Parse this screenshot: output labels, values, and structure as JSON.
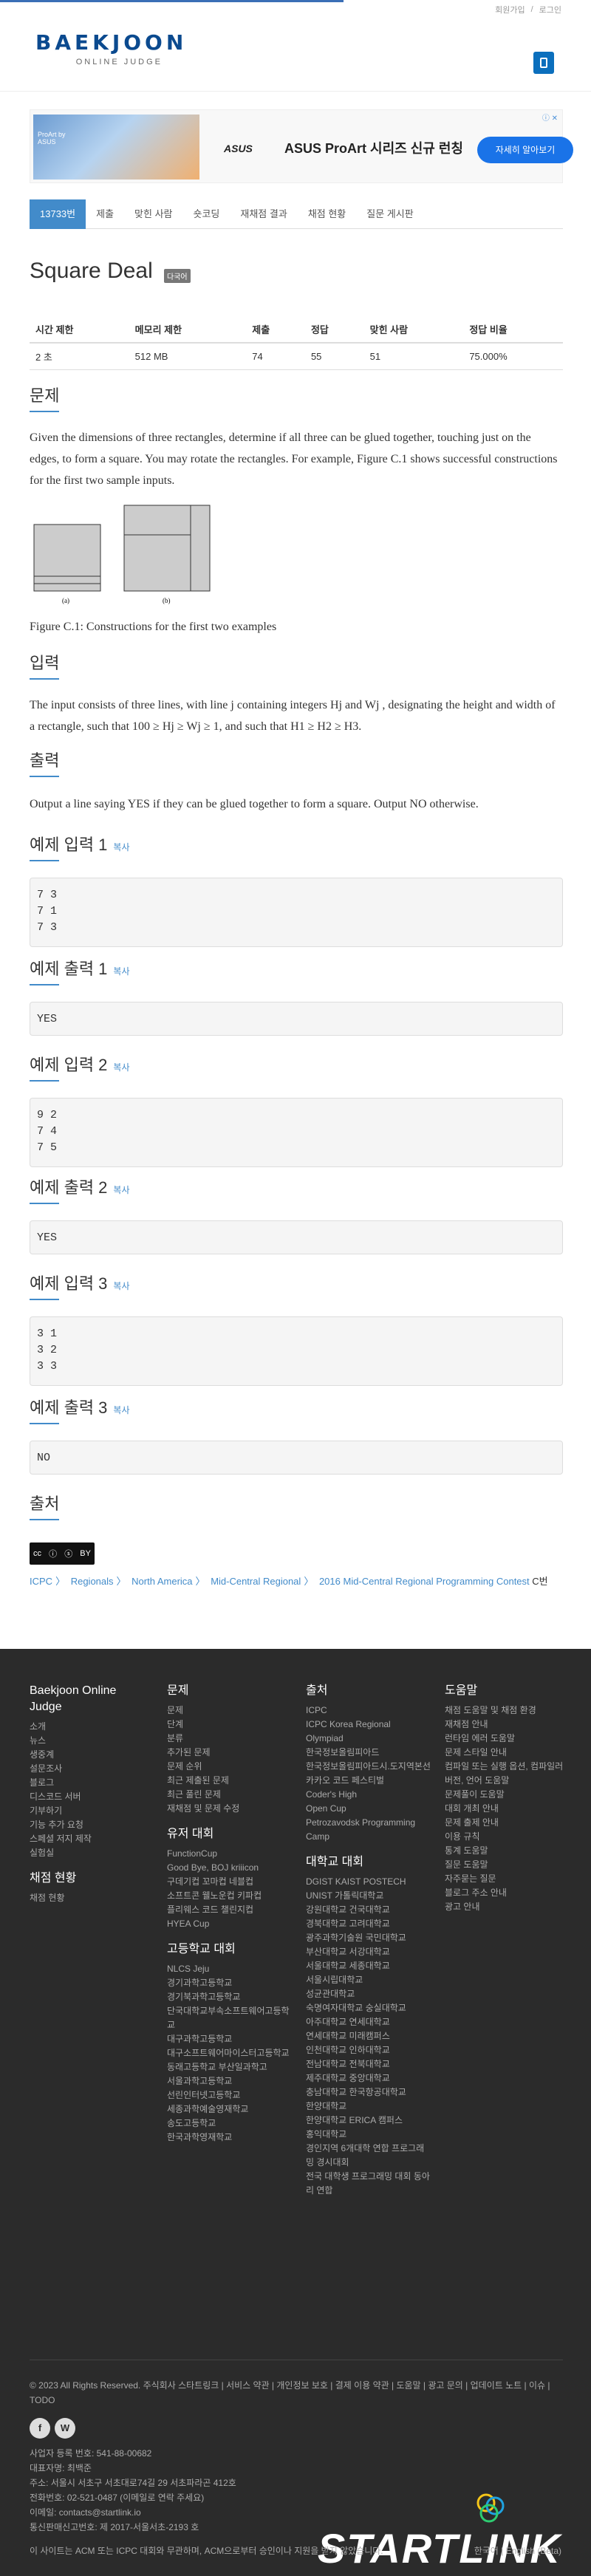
{
  "topbar": {
    "signup": "회원가입",
    "login": "로그인"
  },
  "logo": {
    "main": "BAEKJOON",
    "sub": "ONLINE JUDGE"
  },
  "ad": {
    "brand": "ASUS",
    "text": "ASUS ProArt 시리즈 신규 런칭",
    "button": "자세히 알아보기",
    "img_text": "ProArt by ASUS"
  },
  "tabs": [
    "13733번",
    "제출",
    "맞힌 사람",
    "숏코딩",
    "재채점 결과",
    "채점 현황",
    "질문 게시판"
  ],
  "problem": {
    "title": "Square Deal",
    "label": "다국어"
  },
  "info": {
    "headers": [
      "시간 제한",
      "메모리 제한",
      "제출",
      "정답",
      "맞힌 사람",
      "정답 비율"
    ],
    "values": [
      "2 초",
      "512 MB",
      "74",
      "55",
      "51",
      "75.000%"
    ]
  },
  "sections": {
    "problem": "문제",
    "input": "입력",
    "output": "출력",
    "source": "출처",
    "copy": "복사"
  },
  "text": {
    "problem": "Given the dimensions of three rectangles, determine if all three can be glued together, touching just on the edges, to form a square. You may rotate the rectangles. For example, Figure C.1 shows successful constructions for the first two sample inputs.",
    "caption": "Figure C.1: Constructions for the first two examples",
    "fig_a": "(a)",
    "fig_b": "(b)",
    "input": "The input consists of three lines, with line j containing integers Hj and Wj , designating the height and width of a rectangle, such that 100 ≥ Hj ≥ Wj ≥ 1, and such that H1 ≥ H2 ≥ H3.",
    "output": "Output a line saying YES if they can be glued together to form a square. Output NO otherwise."
  },
  "samples": [
    {
      "in_title": "예제 입력 1",
      "in": "7 3\n7 1\n7 3",
      "out_title": "예제 출력 1",
      "out": "YES"
    },
    {
      "in_title": "예제 입력 2",
      "in": "9 2\n7 4\n7 5",
      "out_title": "예제 출력 2",
      "out": "YES"
    },
    {
      "in_title": "예제 입력 3",
      "in": "3 1\n3 2\n3 3",
      "out_title": "예제 출력 3",
      "out": "NO"
    }
  ],
  "source": {
    "items": [
      "ICPC",
      "Regionals",
      "North America",
      "Mid-Central Regional",
      "2016 Mid-Central Regional Programming Contest"
    ],
    "suffix": "C번"
  },
  "footer": {
    "col1": {
      "title": "Baekjoon Online Judge",
      "items": [
        "소개",
        "뉴스",
        "생중계",
        "설문조사",
        "블로그",
        "디스코드 서버",
        "기부하기",
        "기능 추가 요청",
        "스페셜 저지 제작",
        "실험실"
      ],
      "title2": "채점 현황",
      "items2": [
        "채점 현황"
      ]
    },
    "col2": {
      "title": "문제",
      "items": [
        "문제",
        "단계",
        "분류",
        "추가된 문제",
        "문제 순위",
        "최근 제출된 문제",
        "최근 풀린 문제",
        "재채점 및 문제 수정"
      ],
      "title2": "유저 대회",
      "items2": [
        "FunctionCup",
        "Good Bye, BOJ kriiicon",
        "구데기컵 꼬마컵 네블컵",
        "소프트콘 웰노운컵 키파컵",
        "플리웨스 코드 챌린지컵",
        "HYEA Cup"
      ],
      "title3": "고등학교 대회",
      "items3": [
        "NLCS Jeju",
        "경기과학고등학교",
        "경기북과학고등학교",
        "단국대학교부속소프트웨어고등학교",
        "대구과학고등학교",
        "대구소프트웨어마이스터고등학교",
        "동래고등학교 부산일과학고",
        "서울과학고등학교",
        "선린인터넷고등학교",
        "세종과학예술영재학교",
        "송도고등학교",
        "한국과학영재학교"
      ]
    },
    "col3": {
      "title": "출처",
      "items": [
        "ICPC",
        "ICPC Korea Regional",
        "Olympiad",
        "한국정보올림피아드",
        "한국정보올림피아드시.도지역본선",
        "카카오 코드 페스티벌",
        "Coder's High",
        "Open Cup",
        "Petrozavodsk Programming Camp"
      ],
      "title2": "대학교 대회",
      "items2": [
        "DGIST KAIST POSTECH UNIST 가톨릭대학교",
        "강원대학교 건국대학교",
        "경북대학교 고려대학교",
        "광주과학기술원 국민대학교",
        "부산대학교 서강대학교",
        "서울대학교 세종대학교",
        "서울시립대학교",
        "성균관대학교",
        "숙명여자대학교 숭실대학교",
        "아주대학교 연세대학교",
        "연세대학교 미래캠퍼스",
        "인천대학교 인하대학교",
        "전남대학교 전북대학교",
        "제주대학교 중앙대학교",
        "충남대학교 한국항공대학교",
        "한양대학교",
        "한양대학교 ERICA 캠퍼스",
        "홍익대학교",
        "경인지역 6개대학 연합 프로그래밍 경시대회",
        "전국 대학생 프로그래밍 대회 동아리 연합"
      ]
    },
    "col4": {
      "title": "도움말",
      "items": [
        "채점 도움말 및 채점 환경",
        "재채점 안내",
        "런타임 에러 도움말",
        "문제 스타일 안내",
        "컴파일 또는 실행 옵션, 컴파일러 버전, 언어 도움말",
        "문제풀이 도움말",
        "대회 개최 안내",
        "문제 출제 안내",
        "이용 규칙",
        "통계 도움말",
        "질문 도움말",
        "자주묻는 질문",
        "블로그 주소 안내",
        "광고 안내"
      ]
    },
    "bottom_links": "© 2023 All Rights Reserved. 주식회사 스타트링크  |  서비스 약관  |  개인정보 보호  |  결제 이용 약관  |  도움말  |  광고 문의  |  업데이트 노트  |  이슈  |  TODO",
    "biz": [
      "사업자 등록 번호: 541-88-00682",
      "대표자명: 최백준",
      "주소: 서울시 서초구 서초대로74길 29 서초파라곤 412호",
      "전화번호: 02-521-0487 (이메일로 연락 주세요)",
      "이메일: contacts@startlink.io",
      "통신판매신고번호: 제 2017-서울서초-2193 호"
    ],
    "note": "이 사이트는 ACM 또는 ICPC 대회와 무관하며, ACM으로부터 승인이나 지원을 받지 않았습니다.",
    "lang": "한국어 | English (Beta)",
    "brand": "STARTLINK"
  }
}
